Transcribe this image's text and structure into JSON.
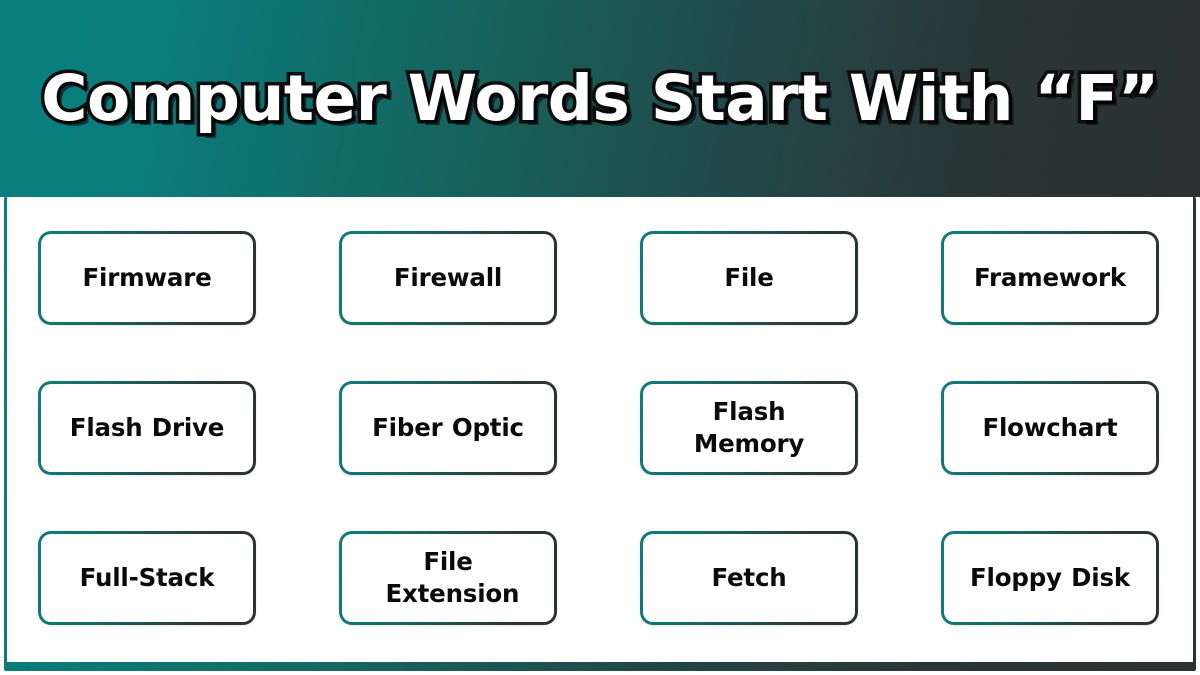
{
  "header": {
    "title": "Computer Words Start With “F”",
    "gradient_from": "#07807f",
    "gradient_to": "#2b3232",
    "title_color": "#ffffff",
    "title_outline_color": "#0d0d0d"
  },
  "panel": {
    "background": "#ffffff",
    "border_gradient_from": "#08807e",
    "border_gradient_to": "#2c3131"
  },
  "cards": {
    "border_gradient_from": "#0e7d7b",
    "border_gradient_to": "#2d3232",
    "text_color": "#0b0b0b",
    "items": [
      {
        "label": "Firmware",
        "wrap": false
      },
      {
        "label": "Firewall",
        "wrap": false
      },
      {
        "label": "File",
        "wrap": false
      },
      {
        "label": "Framework",
        "wrap": false
      },
      {
        "label": "Flash Drive",
        "wrap": false
      },
      {
        "label": "Fiber Optic",
        "wrap": false
      },
      {
        "label": "Flash Memory",
        "wrap": true
      },
      {
        "label": "Flowchart",
        "wrap": false
      },
      {
        "label": "Full-Stack",
        "wrap": false
      },
      {
        "label": "File Extension",
        "wrap": true
      },
      {
        "label": "Fetch",
        "wrap": false
      },
      {
        "label": "Floppy Disk",
        "wrap": false
      }
    ]
  }
}
